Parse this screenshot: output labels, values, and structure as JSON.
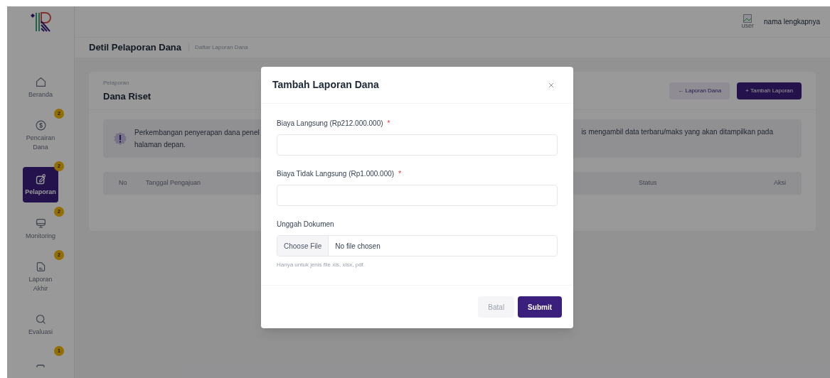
{
  "sidebar": {
    "items": [
      {
        "label": "Beranda",
        "selected": false
      },
      {
        "label": "Pencairan Dana",
        "selected": false,
        "badge": "2"
      },
      {
        "label": "Pelaporan",
        "selected": true,
        "badge": "2"
      },
      {
        "label": "Monitoring",
        "selected": false,
        "badge": "2"
      },
      {
        "label": "Laporan Akhir",
        "selected": false,
        "badge": "2"
      },
      {
        "label": "Evaluasi",
        "selected": false
      },
      {
        "selected": false,
        "badge": "1"
      }
    ]
  },
  "header": {
    "avatar_alt": "user",
    "user_name": "nama lengkapnya"
  },
  "page_header": {
    "title": "Detil Pelaporan Dana",
    "breadcrumb": "Daftar Laporan Dana"
  },
  "card": {
    "subtitle": "Pelaporan",
    "title": "Dana Riset",
    "buttons": [
      {
        "label": "Laporan Dana",
        "icon": "←",
        "kind": "secondary"
      },
      {
        "label": "Tambah Laporan",
        "icon": "+",
        "kind": "primary"
      }
    ],
    "alert": {
      "left_lines": [
        "Perkembangan penyerapan dana penel",
        "halaman depan."
      ],
      "right_text": "is mengambil data terbaru/maks yang akan ditampilkan pada"
    },
    "table": {
      "columns": [
        "No",
        "Tanggal Pengajuan",
        "Status",
        "Aksi"
      ]
    }
  },
  "modal": {
    "title": "Tambah Laporan Dana",
    "fields": [
      {
        "label": "Biaya Langsung (Rp212.000.000)",
        "required_mark": "*",
        "kind": "text"
      },
      {
        "label": "Biaya Tidak Langsung (Rp1.000.000)",
        "required_mark": "*",
        "kind": "text"
      },
      {
        "label": "Unggah Dokumen",
        "kind": "file",
        "button": "Choose File",
        "value": "No file chosen",
        "help": "Hanya untuk jenis file xls, xlsx, pdf."
      }
    ],
    "buttons": [
      {
        "label": "Batal",
        "kind": "secondary"
      },
      {
        "label": "Submit",
        "kind": "primary"
      }
    ]
  }
}
